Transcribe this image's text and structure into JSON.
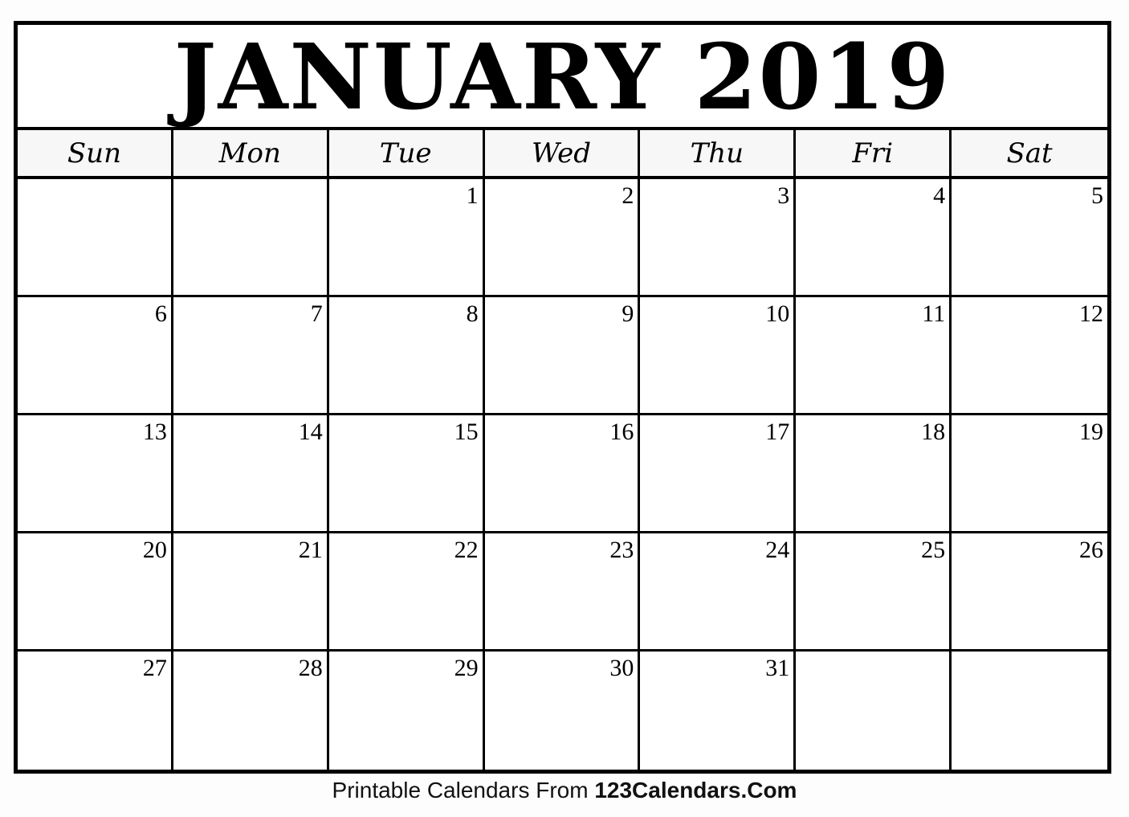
{
  "calendar": {
    "title": "JANUARY 2019",
    "month": "JANUARY",
    "year": "2019",
    "weekdays": [
      "Sun",
      "Mon",
      "Tue",
      "Wed",
      "Thu",
      "Fri",
      "Sat"
    ],
    "weeks": [
      [
        "",
        "",
        "1",
        "2",
        "3",
        "4",
        "5"
      ],
      [
        "6",
        "7",
        "8",
        "9",
        "10",
        "11",
        "12"
      ],
      [
        "13",
        "14",
        "15",
        "16",
        "17",
        "18",
        "19"
      ],
      [
        "20",
        "21",
        "22",
        "23",
        "24",
        "25",
        "26"
      ],
      [
        "27",
        "28",
        "29",
        "30",
        "31",
        "",
        ""
      ]
    ]
  },
  "footer": {
    "prefix": "Printable Calendars From ",
    "brand": "123Calendars.Com"
  },
  "colors": {
    "border": "#000000",
    "header_background": "#f7f7f7",
    "page_background": "#ffffff"
  }
}
